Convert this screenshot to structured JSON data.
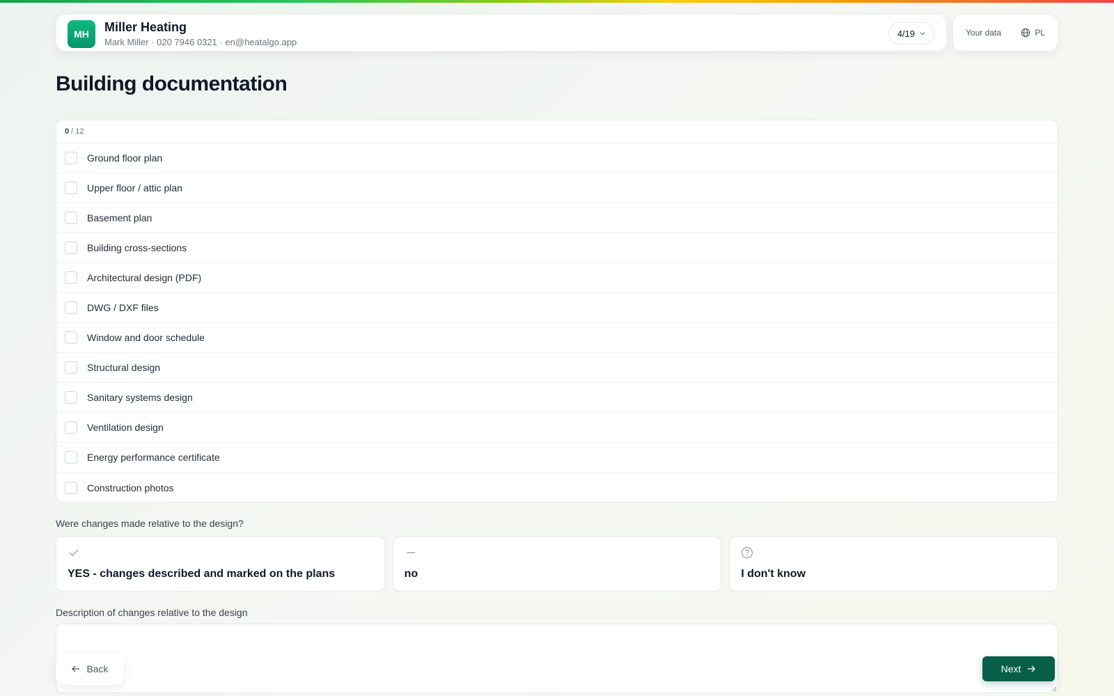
{
  "header": {
    "avatar_initials": "MH",
    "company_name": "Miller Heating",
    "contact": "Mark Miller · 020 7946 0321 · en@heatalgo.app",
    "step_indicator": "4/19"
  },
  "side": {
    "your_data_label": "Your data",
    "language": "PL"
  },
  "page": {
    "title": "Building documentation"
  },
  "checklist": {
    "checked_count": "0",
    "total_label": "/ 12",
    "items": [
      {
        "label": "Ground floor plan",
        "checked": false
      },
      {
        "label": "Upper floor / attic plan",
        "checked": false
      },
      {
        "label": "Basement plan",
        "checked": false
      },
      {
        "label": "Building cross-sections",
        "checked": false
      },
      {
        "label": "Architectural design (PDF)",
        "checked": false
      },
      {
        "label": "DWG / DXF files",
        "checked": false
      },
      {
        "label": "Window and door schedule",
        "checked": false
      },
      {
        "label": "Structural design",
        "checked": false
      },
      {
        "label": "Sanitary systems design",
        "checked": false
      },
      {
        "label": "Ventilation design",
        "checked": false
      },
      {
        "label": "Energy performance certificate",
        "checked": false
      },
      {
        "label": "Construction photos",
        "checked": false
      }
    ]
  },
  "changes": {
    "question": "Were changes made relative to the design?",
    "options": [
      {
        "label": "YES - changes described and marked on the plans",
        "icon": "check-icon"
      },
      {
        "label": "no",
        "icon": "dash-icon"
      },
      {
        "label": "I don't know",
        "icon": "question-circle-icon"
      }
    ],
    "description_label": "Description of changes relative to the design",
    "description_value": ""
  },
  "nav": {
    "back_label": "Back",
    "next_label": "Next"
  },
  "colors": {
    "accent": "#065f46",
    "avatar": "#10b981"
  }
}
